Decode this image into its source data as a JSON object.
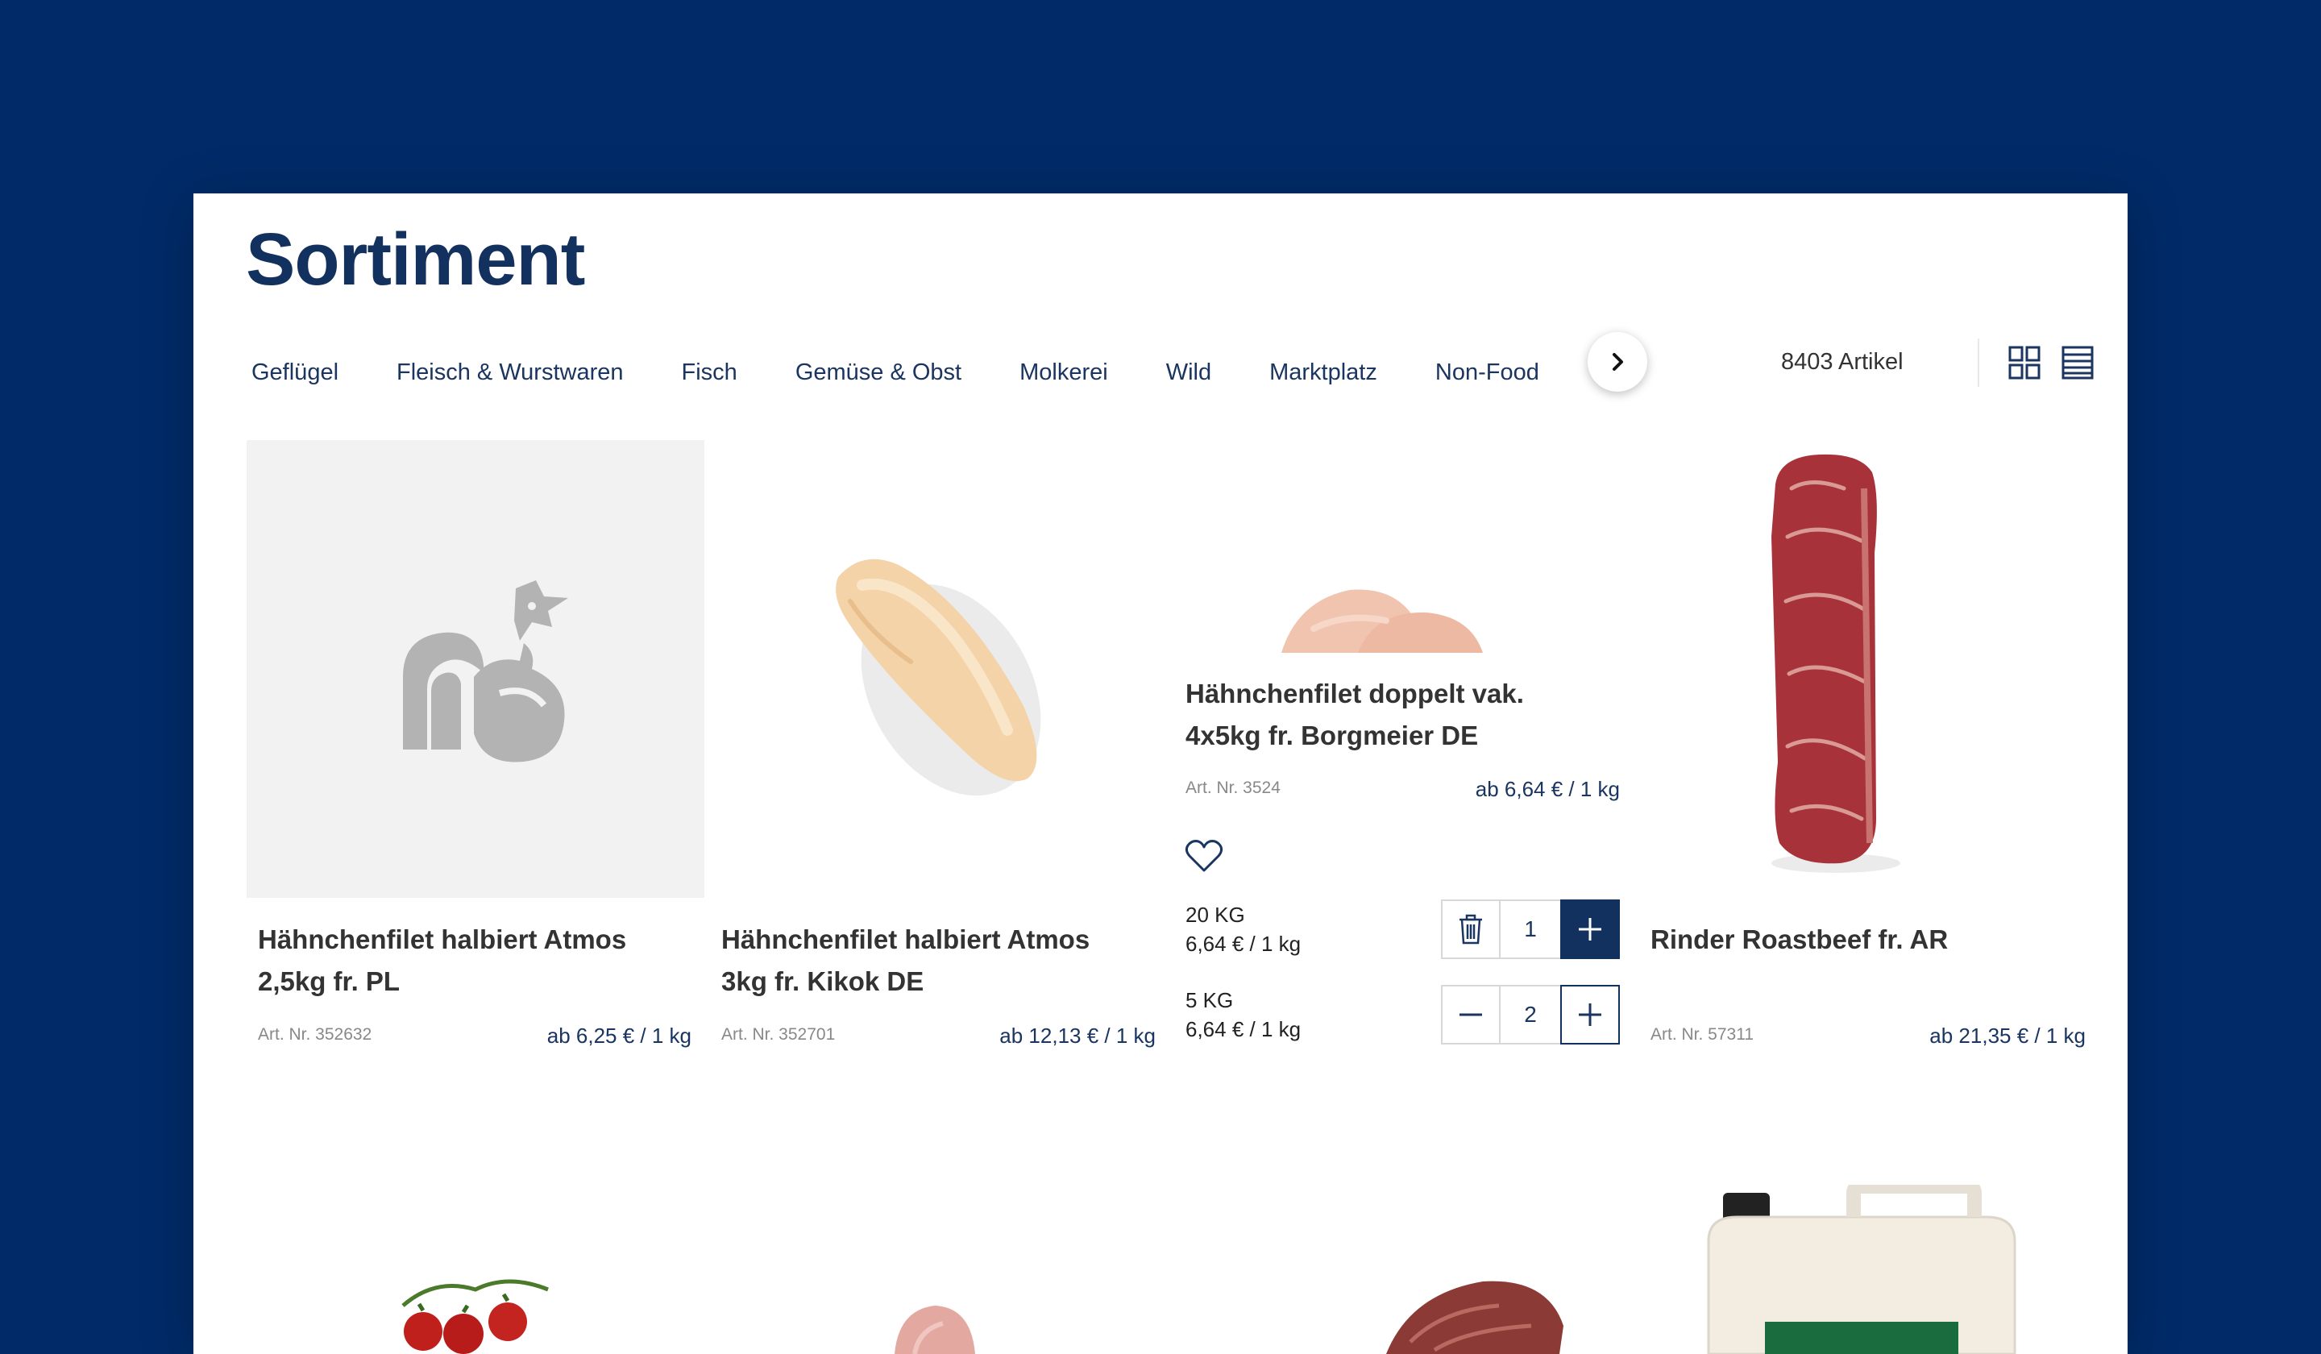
{
  "page": {
    "title": "Sortiment"
  },
  "categories": [
    {
      "label": "Geflügel"
    },
    {
      "label": "Fleisch & Wurstwaren"
    },
    {
      "label": "Fisch"
    },
    {
      "label": "Gemüse & Obst"
    },
    {
      "label": "Molkerei"
    },
    {
      "label": "Wild"
    },
    {
      "label": "Marktplatz"
    },
    {
      "label": "Non-Food"
    }
  ],
  "toolbar": {
    "count": "8403 Artikel",
    "active_view": "grid"
  },
  "products": [
    {
      "name_line1": "Hähnchenfilet halbiert Atmos",
      "name_line2": "2,5kg fr. PL",
      "art": "Art. Nr. 352632",
      "price": "ab 6,25 € / 1 kg"
    },
    {
      "name_line1": "Hähnchenfilet halbiert Atmos",
      "name_line2": "3kg fr. Kikok DE",
      "art": "Art. Nr. 352701",
      "price": "ab 12,13 € / 1 kg"
    },
    {
      "name_line1": "Hähnchenfilet doppelt vak.",
      "name_line2": "4x5kg fr. Borgmeier DE",
      "art": "Art. Nr. 3524",
      "price": "ab 6,64 € / 1 kg",
      "units": [
        {
          "label": "20 KG",
          "price": "6,64 € / 1 kg",
          "qty": "1"
        },
        {
          "label": "5 KG",
          "price": "6,64 € / 1 kg",
          "qty": "2"
        }
      ]
    },
    {
      "name_line1": "Rinder Roastbeef fr. AR",
      "art": "Art. Nr. 57311",
      "price": "ab 21,35 € / 1 kg"
    }
  ],
  "colors": {
    "background": "#002b68",
    "brand": "#13315f",
    "placeholder": "#f2f2f2"
  }
}
